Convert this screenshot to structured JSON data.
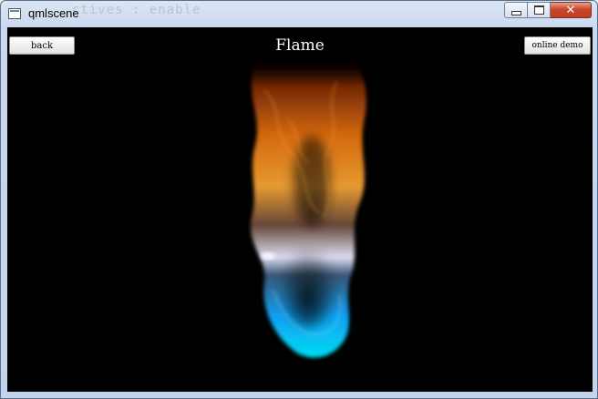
{
  "window": {
    "title": "qmlscene",
    "ghost_title": "ctives : enable",
    "close_glyph": "✕"
  },
  "app": {
    "back_label": "back",
    "heading": "Flame",
    "online_demo_label": "online demo"
  },
  "colors": {
    "flame_top": "#e07010",
    "flame_mid": "#f3a234",
    "flame_white": "#e8e8ff",
    "flame_base": "#12c8ff",
    "background": "#000000"
  },
  "icons": [
    "app-window-icon",
    "minimize-icon",
    "maximize-icon",
    "close-icon",
    "flame-particles"
  ]
}
